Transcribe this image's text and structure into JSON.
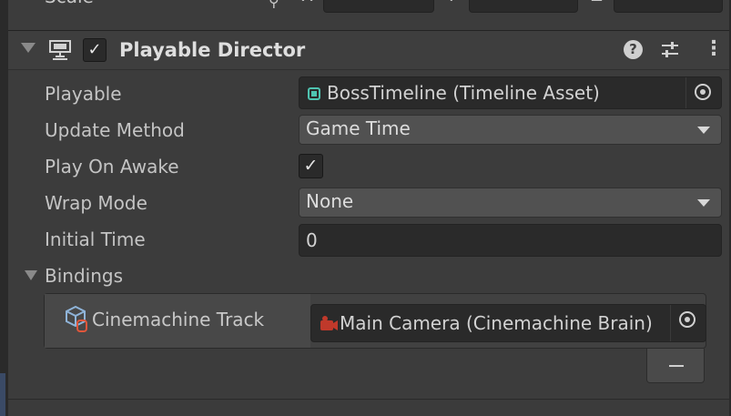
{
  "scale_row": {
    "label": "Scale",
    "axes": [
      {
        "axis": "X",
        "value": ""
      },
      {
        "axis": "Y",
        "value": ""
      },
      {
        "axis": "Z",
        "value": ""
      }
    ]
  },
  "component": {
    "title": "Playable Director",
    "enabled": true,
    "icons": [
      "playable-director-icon",
      "help-icon",
      "preset-icon",
      "context-menu-icon"
    ]
  },
  "properties": {
    "playable": {
      "label": "Playable",
      "value": "BossTimeline (Timeline Asset)"
    },
    "update_method": {
      "label": "Update Method",
      "value": "Game Time"
    },
    "play_on_awake": {
      "label": "Play On Awake",
      "checked": true,
      "check_glyph": "✓"
    },
    "wrap_mode": {
      "label": "Wrap Mode",
      "value": "None"
    },
    "initial_time": {
      "label": "Initial Time",
      "value": "0"
    }
  },
  "bindings": {
    "label": "Bindings",
    "rows": [
      {
        "track": "Cinemachine Track",
        "binding": "Main Camera (Cinemachine Brain)"
      }
    ],
    "remove_glyph": "−"
  },
  "colors": {
    "background": "#3c3c3c",
    "field": "#2a2a2a",
    "dropdown": "#515151",
    "text": "#c8c8c8",
    "timeline_icon": "#4fc3b0",
    "camera_icon": "#c0392b"
  }
}
